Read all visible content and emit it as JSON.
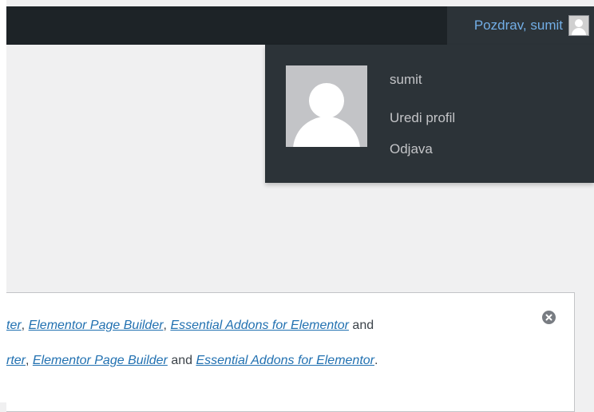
{
  "admin_bar": {
    "greeting": "Pozdrav, sumit",
    "avatar_icon": "user-avatar-icon"
  },
  "account_menu": {
    "username": "sumit",
    "edit_profile": "Uredi profil",
    "logout": "Odjava"
  },
  "notice": {
    "line1": {
      "link1": "ter",
      "sep1": ", ",
      "link2": "Elementor Page Builder",
      "sep2": ", ",
      "link3": "Essential Addons for Elementor",
      "tail": " and"
    },
    "line2": {
      "link1": "rter",
      "sep1": ", ",
      "link2": "Elementor Page Builder",
      "sep2": " and ",
      "link3": "Essential Addons for Elementor",
      "tail": "."
    },
    "dismiss_icon": "dismiss-icon"
  },
  "colors": {
    "admin_bar": "#1d2327",
    "dropdown": "#2c3338",
    "greeting_text": "#72aee6",
    "menu_text": "#c3c4c7",
    "link": "#2271b1",
    "background": "#f0f0f1"
  }
}
